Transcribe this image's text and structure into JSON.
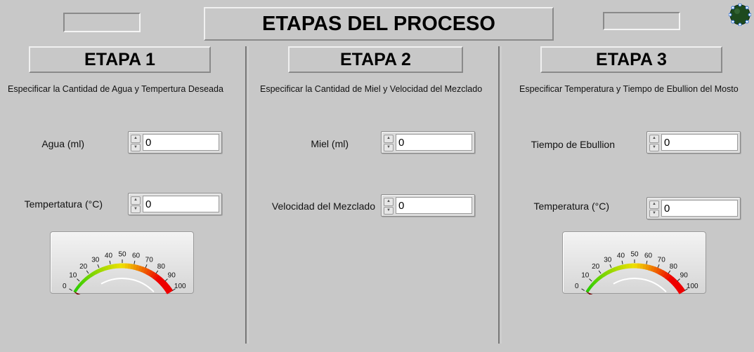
{
  "header": {
    "title": "ETAPAS DEL PROCESO"
  },
  "stages": [
    {
      "title": "ETAPA 1",
      "description": "Especificar la Cantidad de Agua y Tempertura Deseada",
      "controls": [
        {
          "label": "Agua (ml)",
          "value": "0"
        },
        {
          "label": "Tempertatura (°C)",
          "value": "0"
        }
      ],
      "gauge": {
        "value": 0,
        "min": 0,
        "max": 100
      }
    },
    {
      "title": "ETAPA 2",
      "description": "Especificar la Cantidad de Miel y Velocidad del Mezclado",
      "controls": [
        {
          "label": "Miel (ml)",
          "value": "0"
        },
        {
          "label": "Velocidad del Mezclado",
          "value": "0"
        }
      ]
    },
    {
      "title": "ETAPA 3",
      "description": "Especificar Temperatura y Tiempo de Ebullion del Mosto",
      "controls": [
        {
          "label": "Tiempo de Ebullion",
          "value": "0"
        },
        {
          "label": "Temperatura (°C)",
          "value": "0"
        }
      ],
      "gauge": {
        "value": 0,
        "min": 0,
        "max": 100
      }
    }
  ],
  "gauge_ticks": [
    "0",
    "10",
    "20",
    "30",
    "40",
    "50",
    "60",
    "70",
    "80",
    "90",
    "100"
  ],
  "colors": {
    "background": "#c8c8c8",
    "needle": "#7a0000",
    "arc_green": "#22cc00",
    "arc_yellow": "#f0e000",
    "arc_red": "#ee0000",
    "led": "#1e4a1e"
  },
  "icons": {
    "status_led": "led-indicator-icon",
    "spinner_up": "triangle-up",
    "spinner_down": "triangle-down"
  }
}
